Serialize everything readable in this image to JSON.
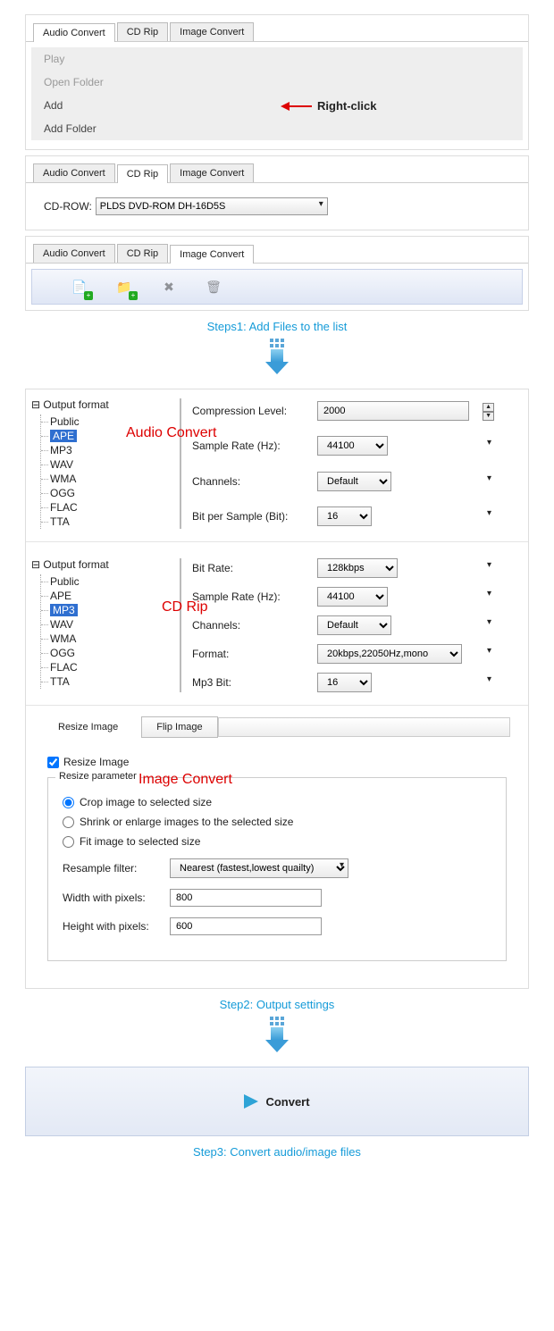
{
  "section1": {
    "tabs": [
      "Audio Convert",
      "CD Rip",
      "Image Convert"
    ],
    "active": 0,
    "menu": {
      "play": "Play",
      "openFolder": "Open Folder",
      "add": "Add",
      "addFolder": "Add Folder"
    },
    "rightClick": "Right-click"
  },
  "section2": {
    "tabs": [
      "Audio Convert",
      "CD Rip",
      "Image Convert"
    ],
    "active": 1,
    "cdRowLabel": "CD-ROW:",
    "cdRowValue": "PLDS    DVD-ROM DH-16D5S"
  },
  "section3": {
    "tabs": [
      "Audio Convert",
      "CD Rip",
      "Image Convert"
    ],
    "active": 2
  },
  "step1": "Steps1: Add Files to the list",
  "audioConvert": {
    "root": "Output format",
    "items": [
      "Public",
      "APE",
      "MP3",
      "WAV",
      "WMA",
      "OGG",
      "FLAC",
      "TTA"
    ],
    "selected": "APE",
    "label": "Audio Convert",
    "fields": {
      "comp": {
        "label": "Compression Level:",
        "value": "2000"
      },
      "rate": {
        "label": "Sample Rate (Hz):",
        "value": "44100"
      },
      "chan": {
        "label": "Channels:",
        "value": "Default"
      },
      "bit": {
        "label": "Bit per Sample (Bit):",
        "value": "16"
      }
    }
  },
  "cdRip": {
    "root": "Output format",
    "items": [
      "Public",
      "APE",
      "MP3",
      "WAV",
      "WMA",
      "OGG",
      "FLAC",
      "TTA"
    ],
    "selected": "MP3",
    "label": "CD Rip",
    "fields": {
      "bitRate": {
        "label": "Bit Rate:",
        "value": "128kbps"
      },
      "rate": {
        "label": "Sample Rate (Hz):",
        "value": "44100"
      },
      "chan": {
        "label": "Channels:",
        "value": "Default"
      },
      "format": {
        "label": "Format:",
        "value": "20kbps,22050Hz,mono"
      },
      "mp3bit": {
        "label": "Mp3 Bit:",
        "value": "16"
      }
    }
  },
  "imageConvert": {
    "tabResize": "Resize Image",
    "tabFlip": "Flip Image",
    "checkResize": "Resize Image",
    "legend": "Resize parameter",
    "label": "Image Convert",
    "radioCrop": "Crop image to selected size",
    "radioShrink": "Shrink or enlarge images to the selected size",
    "radioFit": "Fit image to selected size",
    "resampleLabel": "Resample filter:",
    "resampleValue": "Nearest (fastest,lowest quailty)",
    "widthLabel": "Width with pixels:",
    "widthValue": "800",
    "heightLabel": "Height with pixels:",
    "heightValue": "600"
  },
  "step2": "Step2: Output settings",
  "convert": "Convert",
  "step3": "Step3: Convert audio/image files"
}
